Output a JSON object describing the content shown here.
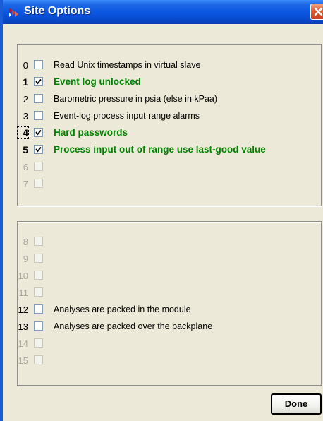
{
  "window": {
    "title": "Site Options",
    "close_label": "X"
  },
  "group1": {
    "rows": [
      {
        "num": "0",
        "checked": false,
        "label": "Read Unix timestamps in virtual slave",
        "style": "normal"
      },
      {
        "num": "1",
        "checked": true,
        "label": "Event log unlocked",
        "style": "highlight"
      },
      {
        "num": "2",
        "checked": false,
        "label": "Barometric pressure in psia (else in kPaa)",
        "style": "normal"
      },
      {
        "num": "3",
        "checked": false,
        "label": "Event-log process input range alarms",
        "style": "normal"
      },
      {
        "num": "4",
        "checked": true,
        "label": "Hard passwords",
        "style": "highlight",
        "focused": true
      },
      {
        "num": "5",
        "checked": true,
        "label": "Process input out of range use last-good value",
        "style": "highlight"
      },
      {
        "num": "6",
        "checked": false,
        "label": "",
        "style": "disabled"
      },
      {
        "num": "7",
        "checked": false,
        "label": "",
        "style": "disabled"
      }
    ]
  },
  "group2": {
    "rows": [
      {
        "num": "8",
        "checked": false,
        "label": "",
        "style": "disabled"
      },
      {
        "num": "9",
        "checked": false,
        "label": "",
        "style": "disabled"
      },
      {
        "num": "10",
        "checked": false,
        "label": "",
        "style": "disabled"
      },
      {
        "num": "11",
        "checked": false,
        "label": "",
        "style": "disabled"
      },
      {
        "num": "12",
        "checked": false,
        "label": "Analyses are packed in the module",
        "style": "normal"
      },
      {
        "num": "13",
        "checked": false,
        "label": "Analyses are packed over the backplane",
        "style": "normal"
      },
      {
        "num": "14",
        "checked": false,
        "label": "",
        "style": "disabled"
      },
      {
        "num": "15",
        "checked": false,
        "label": "",
        "style": "disabled"
      }
    ]
  },
  "buttons": {
    "done_mnemonic": "D",
    "done_rest": "one"
  },
  "colors": {
    "titlebar": "#0a55e0",
    "highlight_text": "#008000",
    "disabled_text": "#a9a9a2",
    "dialog_bg": "#ece9d8"
  }
}
